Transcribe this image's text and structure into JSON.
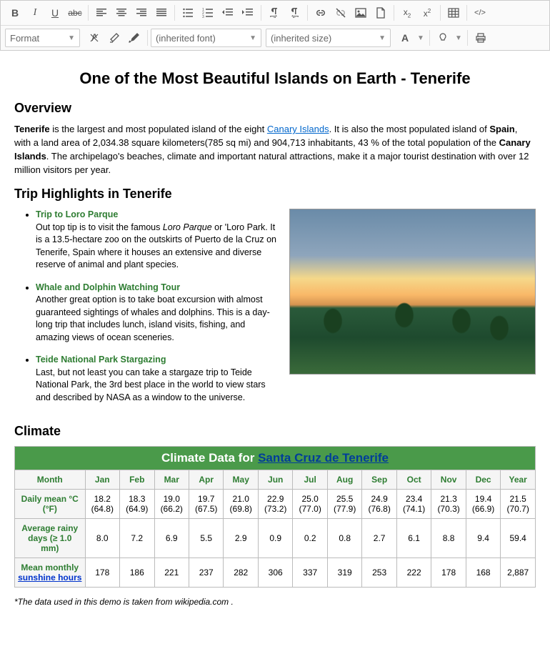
{
  "toolbar": {
    "format_label": "Format",
    "font_label": "(inherited font)",
    "size_label": "(inherited size)",
    "font_letter": "A"
  },
  "doc": {
    "title": "One of the Most Beautiful Islands on Earth - Tenerife",
    "overview_h": "Overview",
    "overview": {
      "p1a": "Tenerife",
      "p1b": " is the largest and most populated island of the eight ",
      "p1c": "Canary Islands",
      "p1d": ". It is also the most populated island of ",
      "p1e": "Spain",
      "p1f": ", with a land area of 2,034.38 square kilometers(785 sq mi) and 904,713 inhabitants, 43 % of the total population of the ",
      "p1g": "Canary Islands",
      "p1h": ". The archipelago's beaches, climate and important natural attractions, make it a major tourist destination with over 12 million visitors per year."
    },
    "trips_h": "Trip Highlights in Tenerife",
    "trips": [
      {
        "title": "Trip to Loro Parque",
        "pre": "Out top tip is to visit the famous ",
        "em": "Loro Parque",
        "post": " or 'Loro Park. It is a 13.5-hectare zoo on the outskirts of Puerto de la Cruz on Tenerife, Spain where it houses an extensive and diverse reserve of animal and plant species."
      },
      {
        "title": "Whale and Dolphin Watching Tour",
        "body": "Another great option is to take boat excursion with almost guaranteed sightings of whales and dolphins. This is a day-long trip that includes lunch, island visits, fishing, and amazing views of ocean sceneries."
      },
      {
        "title": "Teide National Park Stargazing",
        "body": "Last, but not least you can take a stargaze trip to Teide National Park, the 3rd best place in the world to view stars and described by NASA as a window to the universe."
      }
    ],
    "climate_h": "Climate",
    "footnote_a": "*The data used in this demo is taken from ",
    "footnote_b": "wikipedia.com",
    "footnote_c": " ."
  },
  "chart_data": {
    "type": "table",
    "title_prefix": "Climate Data for ",
    "title_link": "Santa Cruz de Tenerife",
    "columns": [
      "Month",
      "Jan",
      "Feb",
      "Mar",
      "Apr",
      "May",
      "Jun",
      "Jul",
      "Aug",
      "Sep",
      "Oct",
      "Nov",
      "Dec",
      "Year"
    ],
    "rows": [
      {
        "label": "Daily mean °C (°F)",
        "cells": [
          "18.2 (64.8)",
          "18.3 (64.9)",
          "19.0 (66.2)",
          "19.7 (67.5)",
          "21.0 (69.8)",
          "22.9 (73.2)",
          "25.0 (77.0)",
          "25.5 (77.9)",
          "24.9 (76.8)",
          "23.4 (74.1)",
          "21.3 (70.3)",
          "19.4 (66.9)",
          "21.5 (70.7)"
        ]
      },
      {
        "label": "Average rainy days (≥ 1.0 mm)",
        "cells": [
          "8.0",
          "7.2",
          "6.9",
          "5.5",
          "2.9",
          "0.9",
          "0.2",
          "0.8",
          "2.7",
          "6.1",
          "8.8",
          "9.4",
          "59.4"
        ]
      },
      {
        "label_pre": "Mean monthly ",
        "label_link": "sunshine hours",
        "cells": [
          "178",
          "186",
          "221",
          "237",
          "282",
          "306",
          "337",
          "319",
          "253",
          "222",
          "178",
          "168",
          "2,887"
        ]
      }
    ]
  }
}
